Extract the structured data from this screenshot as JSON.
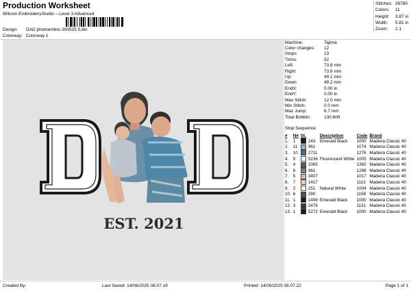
{
  "header": {
    "title": "Production Worksheet",
    "subtitle": "Wilcom EmbroideryStudio – Level 3 Advanced",
    "design_label": "Design:",
    "design_value": "DAD photoembro 300525 5,8in",
    "colorway_label": "Colorway:",
    "colorway_value": "Colorway 1"
  },
  "stats": [
    {
      "label": "Stitches:",
      "value": "26780"
    },
    {
      "label": "Colors:",
      "value": "11"
    },
    {
      "label": "Height:",
      "value": "3.87 in"
    },
    {
      "label": "Width:",
      "value": "5.81 in"
    },
    {
      "label": "Zoom:",
      "value": "1:1"
    }
  ],
  "machine_info": [
    {
      "label": "Machine:",
      "value": "Tajima"
    },
    {
      "label": "Color changes:",
      "value": "12"
    },
    {
      "label": "Stops:",
      "value": "13"
    },
    {
      "label": "Trims:",
      "value": "52"
    },
    {
      "label": "Left:",
      "value": "73.8 mm"
    },
    {
      "label": "Right:",
      "value": "73.8 mm"
    },
    {
      "label": "Up:",
      "value": "49.2 mm"
    },
    {
      "label": "Down:",
      "value": "49.2 mm"
    },
    {
      "label": "EndX:",
      "value": "0.00 in"
    },
    {
      "label": "EndY:",
      "value": "0.00 in"
    },
    {
      "label": "Max Stitch:",
      "value": "12.0 mm"
    },
    {
      "label": "Min Stitch:",
      "value": "0.0 mm"
    },
    {
      "label": "Max Jump:",
      "value": "6.7 mm"
    },
    {
      "label": "Total Bobbin:",
      "value": "130.60ft"
    }
  ],
  "stop_sequence": {
    "heading": "Stop Sequence:",
    "headers": [
      "#",
      "N#",
      "St.",
      "Description",
      "Code",
      "Brand"
    ],
    "rows": [
      {
        "num": "1.",
        "n": "1",
        "color": "#1a1a1a",
        "st": "243",
        "desc": "Emerald Black",
        "code": "1000",
        "brand": "Madeira Classic 40"
      },
      {
        "num": "2.",
        "n": "11",
        "color": "#8fb3cf",
        "st": "961",
        "desc": "",
        "code": "1074",
        "brand": "Madeira Classic 40"
      },
      {
        "num": "3.",
        "n": "10",
        "color": "#3f6f8f",
        "st": "2711",
        "desc": "",
        "code": "1276",
        "brand": "Madeira Classic 40"
      },
      {
        "num": "4.",
        "n": "9",
        "color": "#f4f6f8",
        "st": "5236",
        "desc": "Fluorescent White",
        "code": "1005",
        "brand": "Madeira Classic 40"
      },
      {
        "num": "5.",
        "n": "4",
        "color": "#5a5a5a",
        "st": "2065",
        "desc": "",
        "code": "1365",
        "brand": "Madeira Classic 40"
      },
      {
        "num": "6.",
        "n": "8",
        "color": "#7c7c7c",
        "st": "961",
        "desc": "",
        "code": "1288",
        "brand": "Madeira Classic 40"
      },
      {
        "num": "7.",
        "n": "5",
        "color": "#e0b79a",
        "st": "3407",
        "desc": "",
        "code": "1017",
        "brand": "Madeira Classic 40"
      },
      {
        "num": "8.",
        "n": "7",
        "color": "#f0c9b8",
        "st": "1417",
        "desc": "",
        "code": "1113",
        "brand": "Madeira Classic 40"
      },
      {
        "num": "9.",
        "n": "2",
        "color": "#f8f8f6",
        "st": "251",
        "desc": "Natural White",
        "code": "1004",
        "brand": "Madeira Classic 40"
      },
      {
        "num": "10.",
        "n": "6",
        "color": "#6b4536",
        "st": "280",
        "desc": "",
        "code": "1158",
        "brand": "Madeira Classic 40"
      },
      {
        "num": "11.",
        "n": "1",
        "color": "#1a1a1a",
        "st": "1498",
        "desc": "Emerald Black",
        "code": "1000",
        "brand": "Madeira Classic 40"
      },
      {
        "num": "12.",
        "n": "3",
        "color": "#3a3a3a",
        "st": "2476",
        "desc": "",
        "code": "1131",
        "brand": "Madeira Classic 40"
      },
      {
        "num": "13.",
        "n": "1",
        "color": "#1a1a1a",
        "st": "5272",
        "desc": "Emerald Black",
        "code": "1000",
        "brand": "Madeira Classic 40"
      }
    ]
  },
  "design_text": {
    "letter_left": "D",
    "letter_right": "D",
    "est": "EST. 2021"
  },
  "footer": {
    "created": "Created By:",
    "saved": "Last Saved: 14/06/2025 08.07.19",
    "printed": "Printed: 14/06/2025 08.07.22",
    "page": "Page 1 of 1"
  }
}
